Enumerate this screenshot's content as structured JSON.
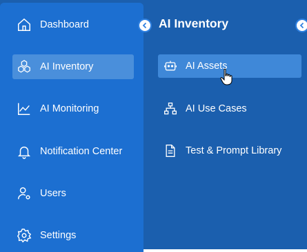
{
  "sidebar": {
    "items": [
      {
        "label": "Dashboard",
        "icon": "home-icon"
      },
      {
        "label": "AI Inventory",
        "icon": "cubes-icon",
        "active": true
      },
      {
        "label": "AI Monitoring",
        "icon": "line-chart-icon"
      },
      {
        "label": "Notification Center",
        "icon": "bell-icon"
      },
      {
        "label": "Users",
        "icon": "user-settings-icon"
      },
      {
        "label": "Settings",
        "icon": "gear-icon"
      }
    ]
  },
  "submenu": {
    "title": "AI Inventory",
    "items": [
      {
        "label": "AI Assets",
        "icon": "robot-icon",
        "active": true
      },
      {
        "label": "AI Use Cases",
        "icon": "hierarchy-icon"
      },
      {
        "label": "Test & Prompt Library",
        "icon": "document-icon"
      }
    ]
  },
  "colors": {
    "sidebar_bg": "#1c6fd1",
    "panel_bg": "#1b5fae",
    "active_bg": "#4a8fdb",
    "text": "#ffffff"
  }
}
